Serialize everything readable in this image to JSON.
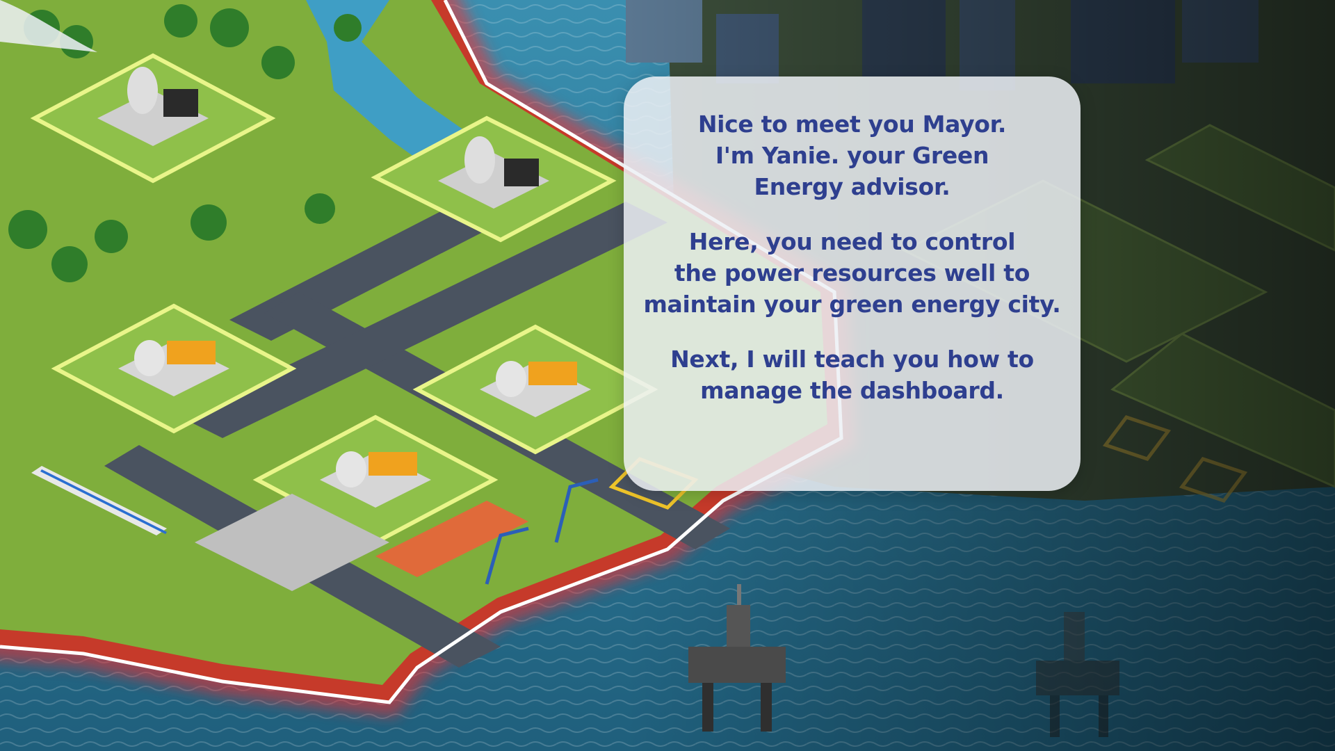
{
  "dialogue": {
    "lines": [
      "Nice to meet you Mayor.\nI'm Yanie. your Green\nEnergy advisor.",
      "Here, you need to control\nthe power resources well to\nmaintain your green energy city.",
      "Next, I will teach you how to\nmanage the dashboard."
    ]
  },
  "colors": {
    "bubble_text": "#2e3f8f",
    "highlight_border": "#ff2a2a",
    "plot_highlight": "#e9f58a",
    "sea": "#2f7f9b"
  },
  "icons": {
    "power_plant": "cooling-tower-plant-icon",
    "oil_rig": "oil-rig-icon",
    "crane": "harbor-crane-icon",
    "train": "train-icon"
  }
}
